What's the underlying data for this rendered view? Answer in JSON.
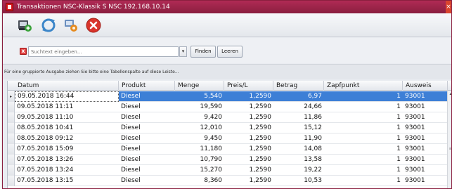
{
  "window": {
    "title": "Transaktionen   NSC-Klassik S  NSC 192.168.10.14",
    "close_glyph": "×"
  },
  "toolbar": {
    "buttons": [
      {
        "name": "export-icon"
      },
      {
        "name": "refresh-icon"
      },
      {
        "name": "settings-icon"
      },
      {
        "name": "close-icon"
      }
    ]
  },
  "search": {
    "placeholder": "Suchtext eingeben...",
    "clear_glyph": "x",
    "dropdown_glyph": "▾",
    "find_label": "Finden",
    "clear_label": "Leeren"
  },
  "group_hint": "Für eine gruppierte Ausgabe ziehen Sie bitte eine Tabellenspalte auf diese Leiste...",
  "table": {
    "columns": [
      "Datum",
      "Produkt",
      "Menge",
      "Preis/L",
      "Betrag",
      "Zapfpunkt",
      "Ausweis"
    ],
    "rows": [
      [
        "09.05.2018 16:44",
        "Diesel",
        "5,540",
        "1,2590",
        "6,97",
        "1",
        "93001"
      ],
      [
        "09.05.2018 11:11",
        "Diesel",
        "19,590",
        "1,2590",
        "24,66",
        "1",
        "93001"
      ],
      [
        "09.05.2018 11:10",
        "Diesel",
        "9,420",
        "1,2590",
        "11,86",
        "1",
        "93001"
      ],
      [
        "08.05.2018 10:41",
        "Diesel",
        "12,010",
        "1,2590",
        "15,12",
        "1",
        "93001"
      ],
      [
        "08.05.2018 09:12",
        "Diesel",
        "9,450",
        "1,2590",
        "11,90",
        "1",
        "93001"
      ],
      [
        "07.05.2018 15:09",
        "Diesel",
        "11,180",
        "1,2590",
        "14,08",
        "1",
        "93001"
      ],
      [
        "07.05.2018 13:26",
        "Diesel",
        "10,790",
        "1,2590",
        "13,58",
        "1",
        "93001"
      ],
      [
        "07.05.2018 13:24",
        "Diesel",
        "15,270",
        "1,2590",
        "19,22",
        "1",
        "93001"
      ],
      [
        "07.05.2018 13:15",
        "Diesel",
        "8,360",
        "1,2590",
        "10,53",
        "1",
        "93001"
      ]
    ],
    "selected_row_index": 0,
    "row_indicator_glyph": "▸",
    "scroll_up_glyph": "▴",
    "scroll_grip_glyph": "≡"
  },
  "colors": {
    "title_bar": "#8a1f3f",
    "selection": "#3d7fd6"
  }
}
